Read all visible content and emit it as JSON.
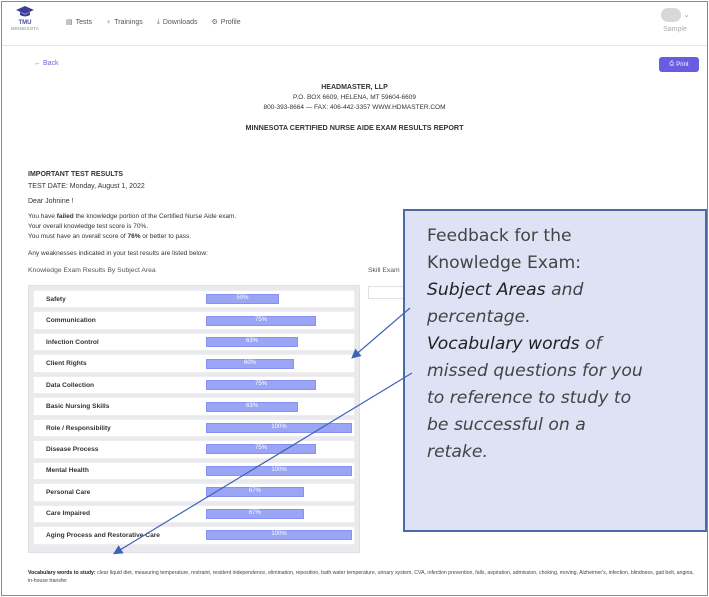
{
  "nav": {
    "logo_line1": "TMU",
    "logo_line2": "MINNESOTA",
    "items": [
      {
        "icon": "document-icon",
        "glyph": "▤",
        "label": "Tests"
      },
      {
        "icon": "lightbulb-icon",
        "glyph": "♀",
        "label": "Trainings"
      },
      {
        "icon": "download-icon",
        "glyph": "⤓",
        "label": "Downloads"
      },
      {
        "icon": "gear-icon",
        "glyph": "⚙",
        "label": "Profile"
      }
    ],
    "profile_name": "Sample"
  },
  "page": {
    "back_label": "← Back",
    "print_label": "Print",
    "company": "HEADMASTER, LLP",
    "address": "P.O. BOX 6609, HELENA, MT 59604-6609",
    "contact": "800-393-8664 — FAX: 406-442-3357 WWW.HDMASTER.COM",
    "report_title": "MINNESOTA CERTIFIED NURSE AIDE EXAM RESULTS REPORT"
  },
  "results": {
    "important": "IMPORTANT TEST RESULTS",
    "test_date": "TEST DATE: Monday, August 1, 2022",
    "greeting": "Dear Johnine !",
    "line1_pre": "You have ",
    "line1_bold": "failed",
    "line1_post": " the knowledge portion of the Certified Nurse Aide exam.",
    "line2": "Your overall knowledge test score is 70%.",
    "line3_pre": "You must have an overall score of ",
    "line3_bold": "76%",
    "line3_post": " or better to pass.",
    "line4": "Any weaknesses indicated in your test results are listed below:",
    "knowledge_heading": "Knowledge Exam Results By Subject Area",
    "skill_heading": "Skill Exam"
  },
  "subjects": [
    {
      "name": "Safety",
      "percent": 50,
      "label": "50%"
    },
    {
      "name": "Communication",
      "percent": 75,
      "label": "75%"
    },
    {
      "name": "Infection Control",
      "percent": 63,
      "label": "63%"
    },
    {
      "name": "Client Rights",
      "percent": 60,
      "label": "60%"
    },
    {
      "name": "Data Collection",
      "percent": 75,
      "label": "75%"
    },
    {
      "name": "Basic Nursing Skills",
      "percent": 63,
      "label": "63%"
    },
    {
      "name": "Role / Responsibility",
      "percent": 100,
      "label": "100%"
    },
    {
      "name": "Disease Process",
      "percent": 75,
      "label": "75%"
    },
    {
      "name": "Mental Health",
      "percent": 100,
      "label": "100%"
    },
    {
      "name": "Personal Care",
      "percent": 67,
      "label": "67%"
    },
    {
      "name": "Care Impaired",
      "percent": 67,
      "label": "67%"
    },
    {
      "name": "Aging Process and Restorative Care",
      "percent": 100,
      "label": "100%"
    }
  ],
  "vocab": {
    "label": "Vocabulary words to study:",
    "words": " clear liquid diet, measuring temperature, restraint, resident independence, elimination, reposition, bath water temperature, urinary system, CVA, infection prevention, falls, aspiration, admission, choking, moving, Alzheimer's, infection, blindness, gait belt, angina, in-house transfer"
  },
  "callout": {
    "l1": "Feedback for the",
    "l2": "Knowledge Exam:",
    "l3_em": "Subject Areas",
    "l3_rest": " and",
    "l4": "percentage.",
    "l5_em": "Vocabulary words",
    "l5_rest": " of",
    "l6": "missed questions for you",
    "l7": "to reference to study to",
    "l8": "be successful on a",
    "l9": "retake."
  },
  "colors": {
    "accent": "#6a5be0",
    "bar_fill": "#9aa5f6",
    "callout_bg": "#dde3f5",
    "callout_border": "#4d6aa8"
  }
}
